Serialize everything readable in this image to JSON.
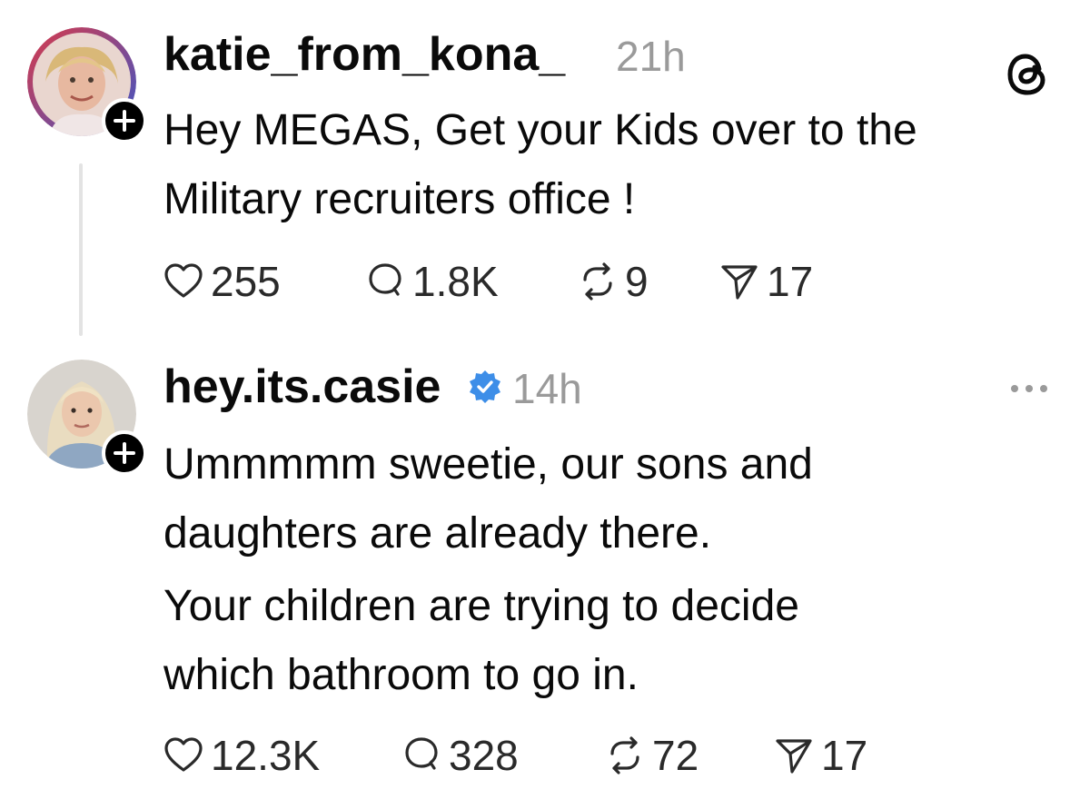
{
  "posts": [
    {
      "username": "katie_from_kona_",
      "time": "21h",
      "verified": false,
      "corner_icon": "threads-logo-icon",
      "lines": [
        "Hey MEGAS, Get your Kids over to the",
        "Military recruiters office !"
      ],
      "stats": {
        "likes": "255",
        "replies": "1.8K",
        "reposts": "9",
        "shares": "17"
      }
    },
    {
      "username": "hey.its.casie",
      "time": "14h",
      "verified": true,
      "corner_icon": "more-options-icon",
      "lines": [
        "Ummmmm sweetie, our sons and",
        "daughters are already there.",
        "Your children are trying to decide",
        "which bathroom to go in."
      ],
      "stats": {
        "likes": "12.3K",
        "replies": "328",
        "reposts": "72",
        "shares": "17"
      }
    }
  ],
  "colors": {
    "text": "#0a0a0a",
    "muted": "#9a9a9a",
    "verified_blue": "#3d8ee8",
    "thread_line": "#e3e3e3"
  }
}
